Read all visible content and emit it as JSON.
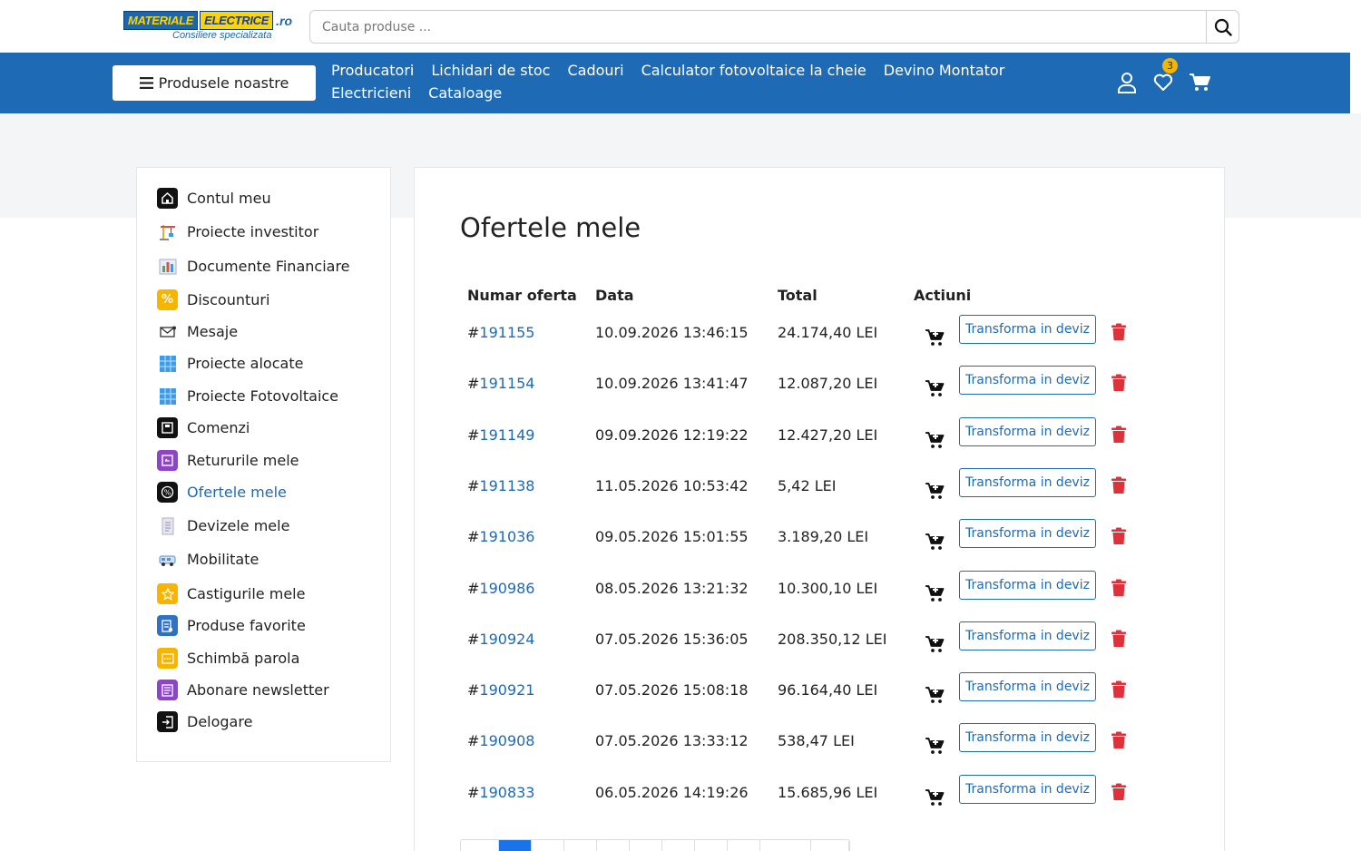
{
  "header": {
    "logo": {
      "part1": "MATERIALE",
      "part2": "ELECTRICE",
      "tld": ".ro",
      "tagline": "Consiliere specializata"
    },
    "search": {
      "placeholder": "Cauta produse ..."
    }
  },
  "nav": {
    "products_button": "Produsele noastre",
    "links": [
      "Producatori",
      "Lichidari de stoc",
      "Cadouri",
      "Calculator fotovoltaice la cheie",
      "Devino Montator",
      "Electricieni",
      "Cataloage"
    ],
    "wishlist_count": "3"
  },
  "sidebar": {
    "items": [
      {
        "label": "Contul meu",
        "icon": "home-icon",
        "color": "#111111"
      },
      {
        "label": "Proiecte investitor",
        "icon": "crane-icon",
        "color": "#f2a93b"
      },
      {
        "label": "Documente Financiare",
        "icon": "bar-chart-icon",
        "color": "#6aa8e0"
      },
      {
        "label": "Discounturi",
        "icon": "percent-icon",
        "color": "#f7b500"
      },
      {
        "label": "Mesaje",
        "icon": "envelope-icon",
        "color": "#333333"
      },
      {
        "label": "Proiecte alocate",
        "icon": "solar-panel-icon",
        "color": "#3d9be9"
      },
      {
        "label": "Proiecte Fotovoltaice",
        "icon": "solar-panel-icon",
        "color": "#3d9be9"
      },
      {
        "label": "Comenzi",
        "icon": "orders-icon",
        "color": "#111111"
      },
      {
        "label": "Retururile mele",
        "icon": "returns-icon",
        "color": "#8e44c9"
      },
      {
        "label": "Ofertele mele",
        "icon": "offers-icon",
        "color": "#111111",
        "active": true
      },
      {
        "label": "Devizele mele",
        "icon": "document-icon",
        "color": "#b0b0c8"
      },
      {
        "label": "Mobilitate",
        "icon": "van-icon",
        "color": "#5a8fd0"
      },
      {
        "label": "Castigurile mele",
        "icon": "star-icon",
        "color": "#f7b500"
      },
      {
        "label": "Produse favorite",
        "icon": "favorites-icon",
        "color": "#2f72c4"
      },
      {
        "label": "Schimbă parola",
        "icon": "password-icon",
        "color": "#f7b500"
      },
      {
        "label": "Abonare newsletter",
        "icon": "newsletter-icon",
        "color": "#8e44c9"
      },
      {
        "label": "Delogare",
        "icon": "logout-icon",
        "color": "#111111"
      }
    ]
  },
  "main": {
    "title": "Ofertele mele",
    "columns": [
      "Numar oferta",
      "Data",
      "Total",
      "Actiuni"
    ],
    "action_label": "Transforma in deviz",
    "rows": [
      {
        "number": "191155",
        "date": "10.09.2026 13:46:15",
        "total": "24.174,40 LEI"
      },
      {
        "number": "191154",
        "date": "10.09.2026 13:41:47",
        "total": "12.087,20 LEI"
      },
      {
        "number": "191149",
        "date": "09.09.2026 12:19:22",
        "total": "12.427,20 LEI"
      },
      {
        "number": "191138",
        "date": "11.05.2026 10:53:42",
        "total": "5,42 LEI"
      },
      {
        "number": "191036",
        "date": "09.05.2026 15:01:55",
        "total": "3.189,20 LEI"
      },
      {
        "number": "190986",
        "date": "08.05.2026 13:21:32",
        "total": "10.300,10 LEI"
      },
      {
        "number": "190924",
        "date": "07.05.2026 15:36:05",
        "total": "208.350,12 LEI"
      },
      {
        "number": "190921",
        "date": "07.05.2026 15:08:18",
        "total": "96.164,40 LEI"
      },
      {
        "number": "190908",
        "date": "07.05.2026 13:33:12",
        "total": "538,47 LEI"
      },
      {
        "number": "190833",
        "date": "06.05.2026 14:19:26",
        "total": "15.685,96 LEI"
      }
    ]
  },
  "colors": {
    "brand_blue": "#1f6ab4",
    "delete_red": "#e0313b",
    "badge_yellow": "#f2b705",
    "pager_active": "#1a73e8"
  }
}
